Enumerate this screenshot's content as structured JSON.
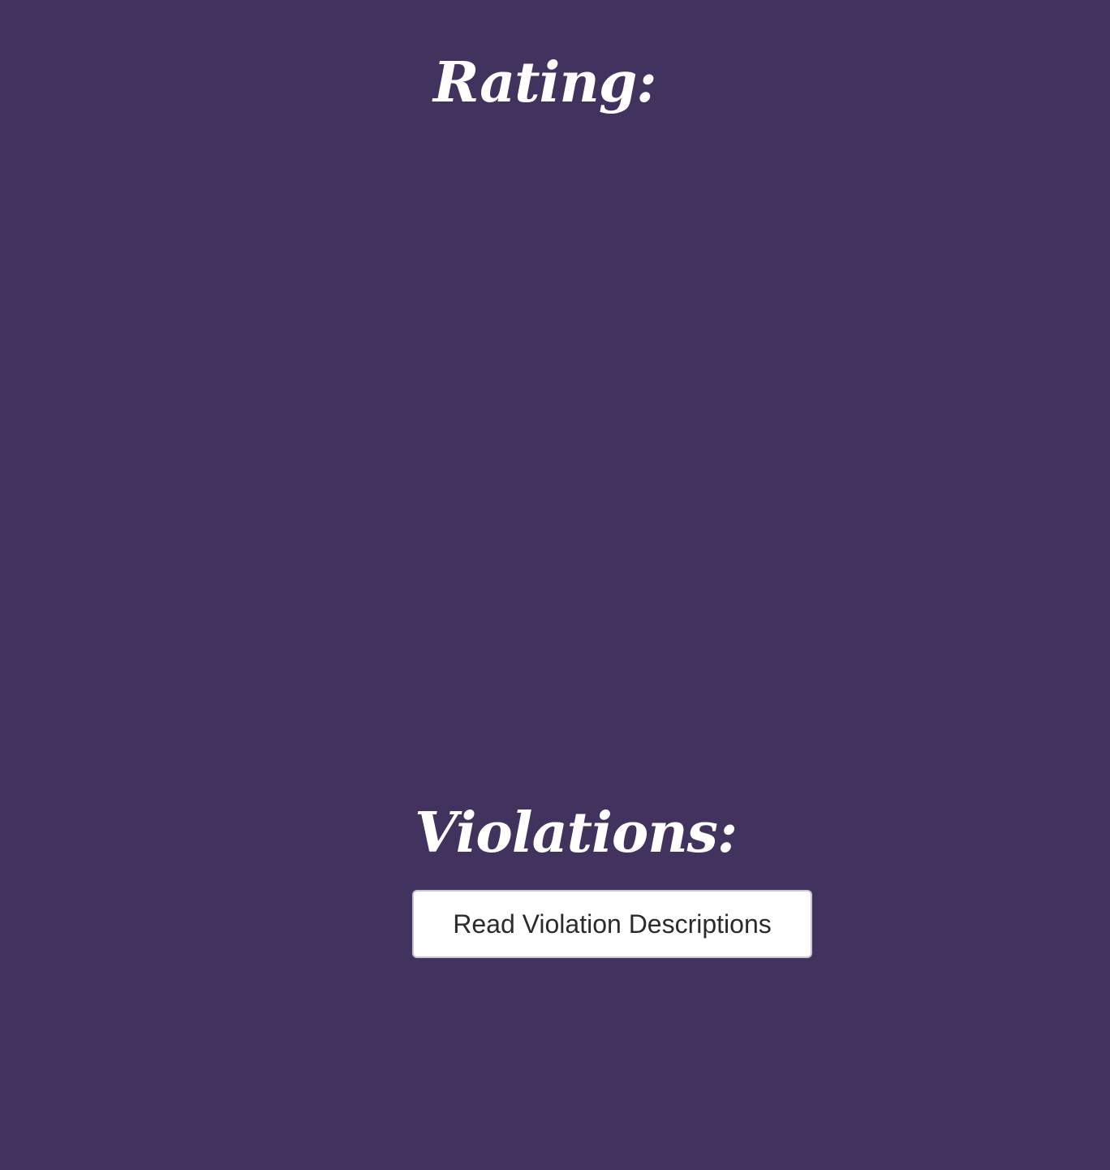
{
  "rating": {
    "heading": "Rating:"
  },
  "violations": {
    "heading": "Violations:",
    "read_button_label": "Read Violation Descriptions"
  },
  "colors": {
    "background": "#41335e",
    "heading_text": "#ffffff",
    "button_background": "#ffffff",
    "button_text": "#2b2b2b"
  }
}
